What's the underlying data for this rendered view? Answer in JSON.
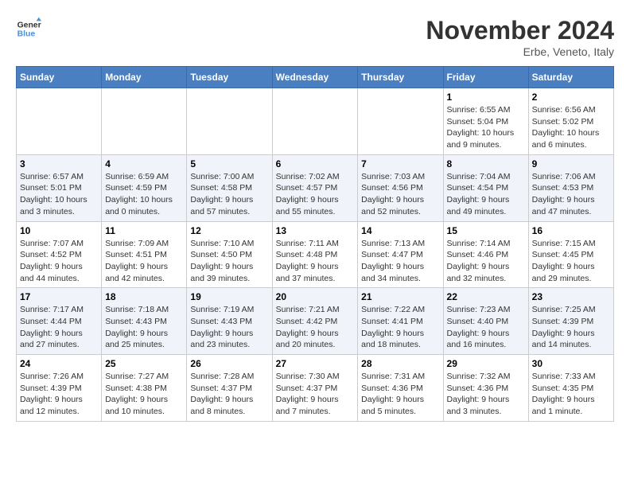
{
  "logo": {
    "line1": "General",
    "line2": "Blue"
  },
  "title": "November 2024",
  "location": "Erbe, Veneto, Italy",
  "headers": [
    "Sunday",
    "Monday",
    "Tuesday",
    "Wednesday",
    "Thursday",
    "Friday",
    "Saturday"
  ],
  "weeks": [
    [
      {
        "day": "",
        "info": ""
      },
      {
        "day": "",
        "info": ""
      },
      {
        "day": "",
        "info": ""
      },
      {
        "day": "",
        "info": ""
      },
      {
        "day": "",
        "info": ""
      },
      {
        "day": "1",
        "info": "Sunrise: 6:55 AM\nSunset: 5:04 PM\nDaylight: 10 hours and 9 minutes."
      },
      {
        "day": "2",
        "info": "Sunrise: 6:56 AM\nSunset: 5:02 PM\nDaylight: 10 hours and 6 minutes."
      }
    ],
    [
      {
        "day": "3",
        "info": "Sunrise: 6:57 AM\nSunset: 5:01 PM\nDaylight: 10 hours and 3 minutes."
      },
      {
        "day": "4",
        "info": "Sunrise: 6:59 AM\nSunset: 4:59 PM\nDaylight: 10 hours and 0 minutes."
      },
      {
        "day": "5",
        "info": "Sunrise: 7:00 AM\nSunset: 4:58 PM\nDaylight: 9 hours and 57 minutes."
      },
      {
        "day": "6",
        "info": "Sunrise: 7:02 AM\nSunset: 4:57 PM\nDaylight: 9 hours and 55 minutes."
      },
      {
        "day": "7",
        "info": "Sunrise: 7:03 AM\nSunset: 4:56 PM\nDaylight: 9 hours and 52 minutes."
      },
      {
        "day": "8",
        "info": "Sunrise: 7:04 AM\nSunset: 4:54 PM\nDaylight: 9 hours and 49 minutes."
      },
      {
        "day": "9",
        "info": "Sunrise: 7:06 AM\nSunset: 4:53 PM\nDaylight: 9 hours and 47 minutes."
      }
    ],
    [
      {
        "day": "10",
        "info": "Sunrise: 7:07 AM\nSunset: 4:52 PM\nDaylight: 9 hours and 44 minutes."
      },
      {
        "day": "11",
        "info": "Sunrise: 7:09 AM\nSunset: 4:51 PM\nDaylight: 9 hours and 42 minutes."
      },
      {
        "day": "12",
        "info": "Sunrise: 7:10 AM\nSunset: 4:50 PM\nDaylight: 9 hours and 39 minutes."
      },
      {
        "day": "13",
        "info": "Sunrise: 7:11 AM\nSunset: 4:48 PM\nDaylight: 9 hours and 37 minutes."
      },
      {
        "day": "14",
        "info": "Sunrise: 7:13 AM\nSunset: 4:47 PM\nDaylight: 9 hours and 34 minutes."
      },
      {
        "day": "15",
        "info": "Sunrise: 7:14 AM\nSunset: 4:46 PM\nDaylight: 9 hours and 32 minutes."
      },
      {
        "day": "16",
        "info": "Sunrise: 7:15 AM\nSunset: 4:45 PM\nDaylight: 9 hours and 29 minutes."
      }
    ],
    [
      {
        "day": "17",
        "info": "Sunrise: 7:17 AM\nSunset: 4:44 PM\nDaylight: 9 hours and 27 minutes."
      },
      {
        "day": "18",
        "info": "Sunrise: 7:18 AM\nSunset: 4:43 PM\nDaylight: 9 hours and 25 minutes."
      },
      {
        "day": "19",
        "info": "Sunrise: 7:19 AM\nSunset: 4:43 PM\nDaylight: 9 hours and 23 minutes."
      },
      {
        "day": "20",
        "info": "Sunrise: 7:21 AM\nSunset: 4:42 PM\nDaylight: 9 hours and 20 minutes."
      },
      {
        "day": "21",
        "info": "Sunrise: 7:22 AM\nSunset: 4:41 PM\nDaylight: 9 hours and 18 minutes."
      },
      {
        "day": "22",
        "info": "Sunrise: 7:23 AM\nSunset: 4:40 PM\nDaylight: 9 hours and 16 minutes."
      },
      {
        "day": "23",
        "info": "Sunrise: 7:25 AM\nSunset: 4:39 PM\nDaylight: 9 hours and 14 minutes."
      }
    ],
    [
      {
        "day": "24",
        "info": "Sunrise: 7:26 AM\nSunset: 4:39 PM\nDaylight: 9 hours and 12 minutes."
      },
      {
        "day": "25",
        "info": "Sunrise: 7:27 AM\nSunset: 4:38 PM\nDaylight: 9 hours and 10 minutes."
      },
      {
        "day": "26",
        "info": "Sunrise: 7:28 AM\nSunset: 4:37 PM\nDaylight: 9 hours and 8 minutes."
      },
      {
        "day": "27",
        "info": "Sunrise: 7:30 AM\nSunset: 4:37 PM\nDaylight: 9 hours and 7 minutes."
      },
      {
        "day": "28",
        "info": "Sunrise: 7:31 AM\nSunset: 4:36 PM\nDaylight: 9 hours and 5 minutes."
      },
      {
        "day": "29",
        "info": "Sunrise: 7:32 AM\nSunset: 4:36 PM\nDaylight: 9 hours and 3 minutes."
      },
      {
        "day": "30",
        "info": "Sunrise: 7:33 AM\nSunset: 4:35 PM\nDaylight: 9 hours and 1 minute."
      }
    ]
  ]
}
